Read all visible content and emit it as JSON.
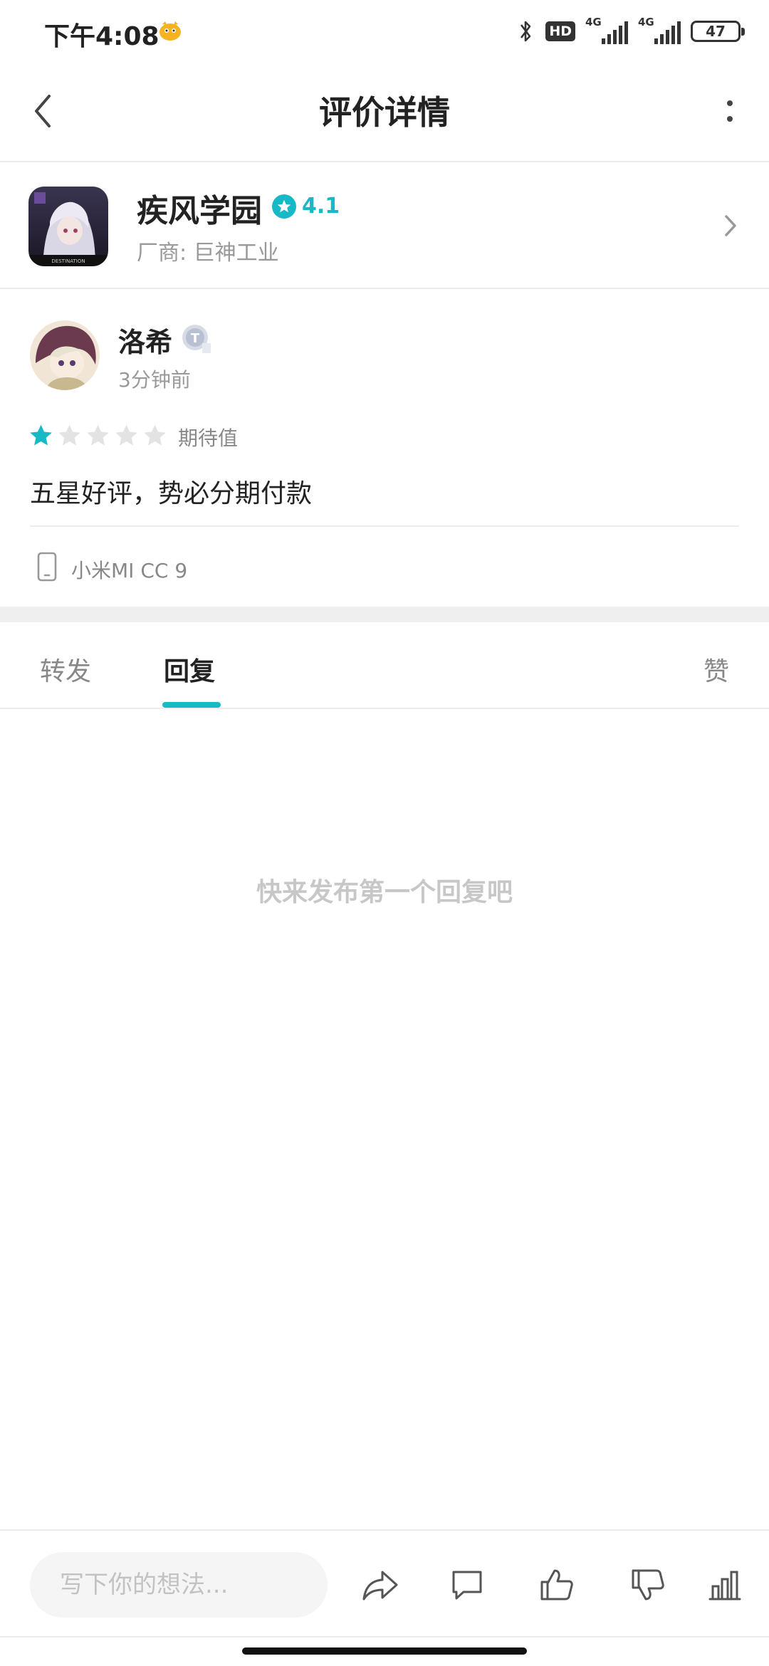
{
  "status_bar": {
    "time": "下午4:08",
    "hd_label": "HD",
    "sim1_label": "4G",
    "sim2_label": "4G",
    "battery": "47"
  },
  "header": {
    "title": "评价详情"
  },
  "app": {
    "name": "疾风学园",
    "rating": "4.1",
    "vendor": "厂商: 巨神工业",
    "icon_caption": "DESTINATION"
  },
  "review": {
    "user_name": "洛希",
    "badge": "T",
    "time_ago": "3分钟前",
    "stars": 1,
    "stars_max": 5,
    "rating_type": "期待值",
    "content": "五星好评，势必分期付款",
    "device": "小米MI CC 9"
  },
  "tabs": [
    {
      "label": "转发"
    },
    {
      "label": "回复"
    },
    {
      "label": "赞"
    }
  ],
  "active_tab": "回复",
  "empty_hint": "快来发布第一个回复吧",
  "composer": {
    "placeholder": "写下你的想法..."
  },
  "colors": {
    "accent": "#18b9c7",
    "star_inactive": "#e3e3e3",
    "divider": "#ececec"
  },
  "icons": {
    "back": "chevron-left-icon",
    "more": "more-vertical-icon",
    "app_chevron": "chevron-right-icon",
    "device": "phone-icon",
    "share": "share-icon",
    "comment": "comment-icon",
    "like": "thumbs-up-icon",
    "dislike": "thumbs-down-icon",
    "stats": "bar-chart-icon"
  }
}
